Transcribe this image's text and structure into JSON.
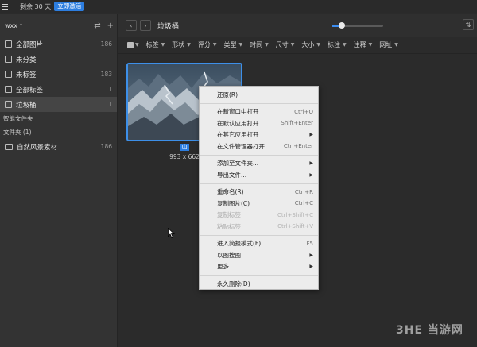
{
  "topbar": {
    "trial_text": "剩余 30 天",
    "activate_label": "立即激活",
    "accent": "#2d7ee0"
  },
  "sidebar": {
    "library_name": "wxx",
    "library_caret": "⌃",
    "items": [
      {
        "label": "全部图片",
        "count": "186",
        "icon": "images-icon"
      },
      {
        "label": "未分类",
        "count": "",
        "icon": "unsorted-icon"
      },
      {
        "label": "未标签",
        "count": "183",
        "icon": "untagged-icon"
      },
      {
        "label": "全部标签",
        "count": "1",
        "icon": "tag-icon"
      },
      {
        "label": "垃圾桶",
        "count": "1",
        "icon": "trash-icon"
      }
    ],
    "smart_folder_heading": "智能文件夹",
    "folder_heading": "文件夹 (1)",
    "folders": [
      {
        "label": "自然风景素材",
        "count": "186"
      }
    ]
  },
  "main": {
    "title": "垃圾桶",
    "zoom_level": 0.2,
    "filters": [
      "标签",
      "形状",
      "评分",
      "类型",
      "时间",
      "尺寸",
      "大小",
      "标注",
      "注释",
      "网址"
    ]
  },
  "grid": {
    "items": [
      {
        "name": "山",
        "size": "993 x 662"
      }
    ]
  },
  "context_menu": {
    "items": [
      {
        "label": "还原(R)",
        "shortcut": "",
        "submenu": false,
        "disabled": false
      },
      {
        "sep": true
      },
      {
        "label": "在新窗口中打开",
        "shortcut": "Ctrl+O",
        "submenu": false,
        "disabled": false
      },
      {
        "label": "在默认应用打开",
        "shortcut": "Shift+Enter",
        "submenu": false,
        "disabled": false
      },
      {
        "label": "在其它应用打开",
        "shortcut": "",
        "submenu": true,
        "disabled": false
      },
      {
        "label": "在文件管理器打开",
        "shortcut": "Ctrl+Enter",
        "submenu": false,
        "disabled": false
      },
      {
        "sep": true
      },
      {
        "label": "添加至文件夹...",
        "shortcut": "",
        "submenu": true,
        "disabled": false
      },
      {
        "label": "导出文件...",
        "shortcut": "",
        "submenu": true,
        "disabled": false
      },
      {
        "sep": true
      },
      {
        "label": "重命名(R)",
        "shortcut": "Ctrl+R",
        "submenu": false,
        "disabled": false
      },
      {
        "label": "复制图片(C)",
        "shortcut": "Ctrl+C",
        "submenu": false,
        "disabled": false
      },
      {
        "label": "复制标签",
        "shortcut": "Ctrl+Shift+C",
        "submenu": false,
        "disabled": true
      },
      {
        "label": "粘贴标签",
        "shortcut": "Ctrl+Shift+V",
        "submenu": false,
        "disabled": true
      },
      {
        "sep": true
      },
      {
        "label": "进入简报模式(F)",
        "shortcut": "F5",
        "submenu": false,
        "disabled": false
      },
      {
        "label": "以图搜图",
        "shortcut": "",
        "submenu": true,
        "disabled": false
      },
      {
        "label": "更多",
        "shortcut": "",
        "submenu": true,
        "disabled": false
      },
      {
        "sep": true
      },
      {
        "label": "永久删除(D)",
        "shortcut": "",
        "submenu": false,
        "disabled": false
      }
    ]
  },
  "watermark": "3HE 当游网"
}
